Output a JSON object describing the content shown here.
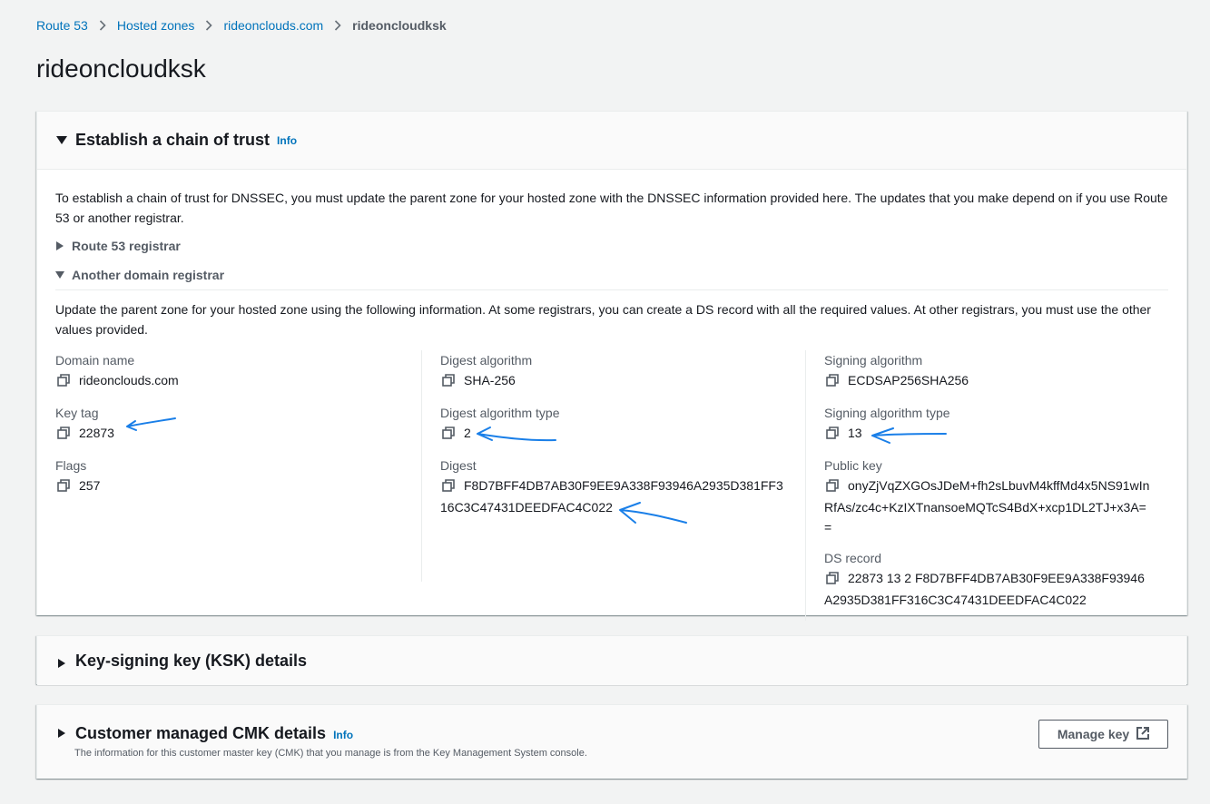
{
  "breadcrumb": {
    "items": [
      "Route 53",
      "Hosted zones",
      "rideonclouds.com"
    ],
    "current": "rideoncloudksk"
  },
  "page": {
    "title": "rideoncloudksk"
  },
  "chain_of_trust": {
    "title": "Establish a chain of trust",
    "info_label": "Info",
    "expanded": true,
    "intro": "To establish a chain of trust for DNSSEC, you must update the parent zone for your hosted zone with the DNSSEC information provided here. The updates that you make depend on if you use Route 53 or another registrar.",
    "route53_registrar": {
      "label": "Route 53 registrar",
      "expanded": false
    },
    "other_registrar": {
      "label": "Another domain registrar",
      "expanded": true
    },
    "other_intro": "Update the parent zone for your hosted zone using the following information. At some registrars, you can create a DS record with all the required values. At other registrars, you must use the other values provided.",
    "fields": {
      "domain_name": {
        "label": "Domain name",
        "value": "rideonclouds.com"
      },
      "key_tag": {
        "label": "Key tag",
        "value": "22873"
      },
      "flags": {
        "label": "Flags",
        "value": "257"
      },
      "digest_algorithm": {
        "label": "Digest algorithm",
        "value": "SHA-256"
      },
      "digest_algorithm_type": {
        "label": "Digest algorithm type",
        "value": "2"
      },
      "digest": {
        "label": "Digest",
        "value": "F8D7BFF4DB7AB30F9EE9A338F93946A2935D381FF316C3C47431DEEDFAC4C022"
      },
      "signing_algorithm": {
        "label": "Signing algorithm",
        "value": "ECDSAP256SHA256"
      },
      "signing_algorithm_type": {
        "label": "Signing algorithm type",
        "value": "13"
      },
      "public_key": {
        "label": "Public key",
        "value": "onyZjVqZXGOsJDeM+fh2sLbuvM4kffMd4x5NS91wInRfAs/zc4c+KzIXTnansoeMQTcS4BdX+xcp1DL2TJ+x3A=="
      },
      "ds_record": {
        "label": "DS record",
        "value": "22873 13 2 F8D7BFF4DB7AB30F9EE9A338F93946A2935D381FF316C3C47431DEEDFAC4C022"
      }
    }
  },
  "ksk_details": {
    "title": "Key-signing key (KSK) details",
    "expanded": false
  },
  "cmk_details": {
    "title": "Customer managed CMK details",
    "info_label": "Info",
    "description": "The information for this customer master key (CMK) that you manage is from the Key Management System console.",
    "manage_key_label": "Manage key",
    "expanded": false
  },
  "colors": {
    "link": "#0073bb",
    "annotation": "#1a7fe8"
  }
}
